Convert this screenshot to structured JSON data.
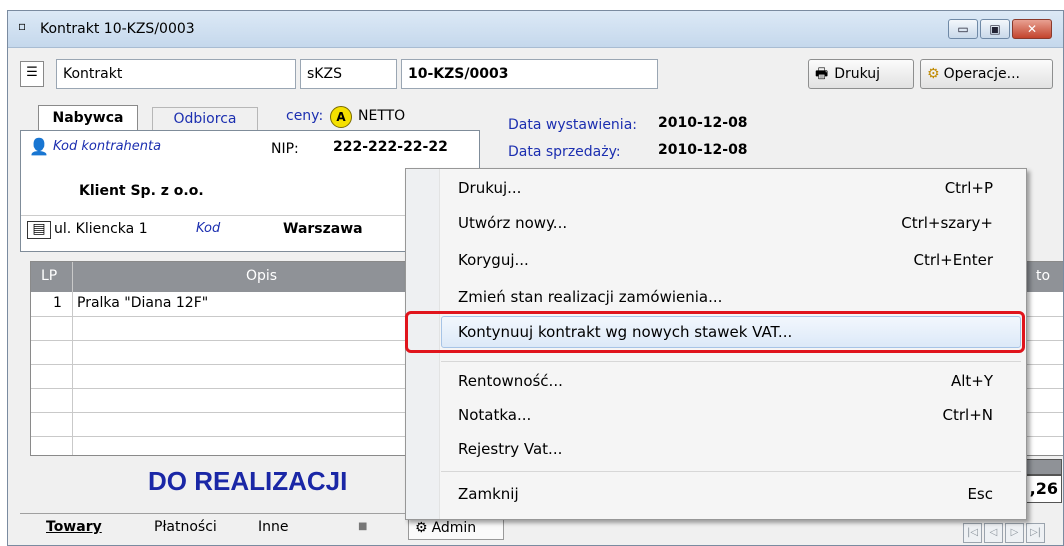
{
  "window": {
    "title": "Kontrakt 10-KZS/0003",
    "controls": {
      "minimize": "▭",
      "maximize": "▣",
      "close": "✕"
    }
  },
  "header": {
    "doc_type": "Kontrakt",
    "series": "sKZS",
    "number": "10-KZS/0003",
    "print_button": "Drukuj",
    "operations_button": "Operacje..."
  },
  "party": {
    "tabs": [
      "Nabywca",
      "Odbiorca"
    ],
    "prices_label": "ceny:",
    "prices_value": "NETTO",
    "prices_badge": "A",
    "contractor_code_placeholder": "Kod kontrahenta",
    "nip_label": "NIP:",
    "nip_value": "222-222-22-22",
    "name": "Klient Sp. z o.o.",
    "street": "ul. Kliencka 1",
    "postcode_placeholder": "Kod",
    "city": "Warszawa"
  },
  "dates": {
    "issue_label": "Data wystawienia:",
    "issue_value": "2010-12-08",
    "sale_label": "Data sprzedaży:",
    "sale_value": "2010-12-08"
  },
  "items_table": {
    "columns": [
      "LP",
      "Opis",
      "to"
    ],
    "rows": [
      {
        "lp": "1",
        "opis": "Pralka \"Diana 12F\""
      }
    ]
  },
  "status": {
    "text": "DO REALIZACJI",
    "total_fragment": ",26"
  },
  "bottom_tabs": {
    "items": [
      "Towary",
      "Płatności",
      "Inne"
    ],
    "admin": "Admin"
  },
  "context_menu": {
    "items": [
      {
        "label": "Drukuj...",
        "shortcut": "Ctrl+P"
      },
      {
        "label": "Utwórz nowy...",
        "shortcut": "Ctrl+szary+"
      },
      {
        "label": "Koryguj...",
        "shortcut": "Ctrl+Enter"
      },
      {
        "label": "Zmień stan realizacji zamówienia...",
        "shortcut": ""
      },
      {
        "label": "Kontynuuj kontrakt wg nowych stawek VAT...",
        "shortcut": "",
        "highlighted": true
      },
      {
        "label": "Rentowność...",
        "shortcut": "Alt+Y"
      },
      {
        "label": "Notatka...",
        "shortcut": "Ctrl+N"
      },
      {
        "label": "Rejestry Vat...",
        "shortcut": ""
      },
      {
        "label": "Zamknij",
        "shortcut": "Esc"
      }
    ]
  },
  "colors": {
    "highlight_border": "#e0141c",
    "status_text": "#1a27a6",
    "grid_header": "#8f9297"
  }
}
